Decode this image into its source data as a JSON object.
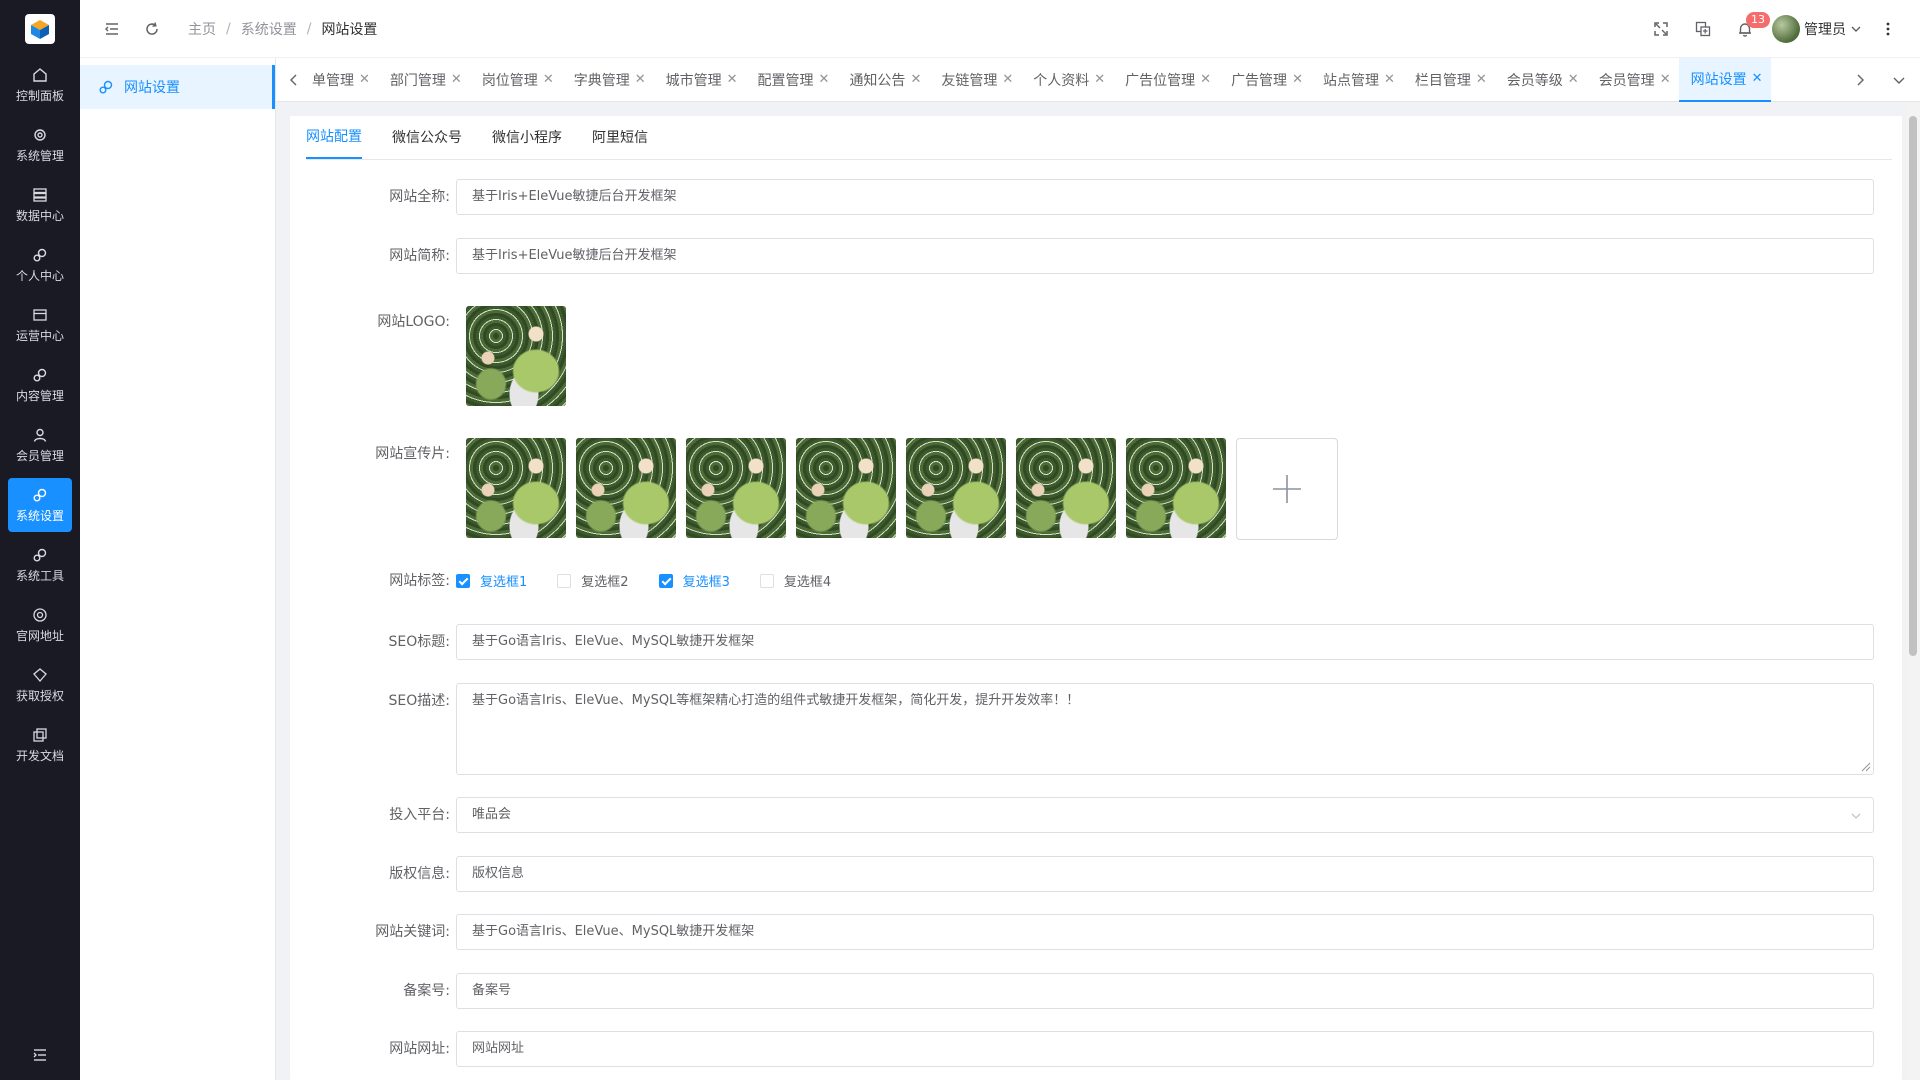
{
  "rail": {
    "items": [
      {
        "label": "控制面板",
        "icon": "home-icon"
      },
      {
        "label": "系统管理",
        "icon": "gear-icon"
      },
      {
        "label": "数据中心",
        "icon": "database-icon"
      },
      {
        "label": "个人中心",
        "icon": "gears-icon"
      },
      {
        "label": "运营中心",
        "icon": "card-icon"
      },
      {
        "label": "内容管理",
        "icon": "gears-icon"
      },
      {
        "label": "会员管理",
        "icon": "user-icon"
      },
      {
        "label": "系统设置",
        "icon": "gears-icon"
      },
      {
        "label": "系统工具",
        "icon": "gears-icon"
      },
      {
        "label": "官网地址",
        "icon": "target-icon"
      },
      {
        "label": "获取授权",
        "icon": "diamond-icon"
      },
      {
        "label": "开发文档",
        "icon": "copy-icon"
      }
    ],
    "active_index": 7
  },
  "subside": {
    "item_label": "网站设置"
  },
  "header": {
    "breadcrumb": [
      "主页",
      "系统设置",
      "网站设置"
    ],
    "notification_count": "13",
    "user_name": "管理员",
    "accent": "#1890ff"
  },
  "tabs": {
    "items": [
      "菜单管理",
      "部门管理",
      "岗位管理",
      "字典管理",
      "城市管理",
      "配置管理",
      "通知公告",
      "友链管理",
      "个人资料",
      "广告位管理",
      "广告管理",
      "站点管理",
      "栏目管理",
      "会员等级",
      "会员管理",
      "网站设置"
    ],
    "first_visible_text": "单管理",
    "active_index": 15
  },
  "subtabs": [
    "网站配置",
    "微信公众号",
    "微信小程序",
    "阿里短信"
  ],
  "form": {
    "site_name_label": "网站全称:",
    "site_name": "基于Iris+EleVue敏捷后台开发框架",
    "site_short_label": "网站简称:",
    "site_short": "基于Iris+EleVue敏捷后台开发框架",
    "logo_label": "网站LOGO:",
    "promo_label": "网站宣传片:",
    "tags_label": "网站标签:",
    "tags": [
      {
        "label": "复选框1",
        "checked": true
      },
      {
        "label": "复选框2",
        "checked": false
      },
      {
        "label": "复选框3",
        "checked": true
      },
      {
        "label": "复选框4",
        "checked": false
      }
    ],
    "seo_title_label": "SEO标题:",
    "seo_title": "基于Go语言Iris、EleVue、MySQL敏捷开发框架",
    "seo_desc_label": "SEO描述:",
    "seo_desc": "基于Go语言Iris、EleVue、MySQL等框架精心打造的组件式敏捷开发框架，简化开发，提升开发效率！！",
    "platform_label": "投入平台:",
    "platform": "唯品会",
    "copyright_label": "版权信息:",
    "copyright": "版权信息",
    "keywords_label": "网站关键词:",
    "keywords": "基于Go语言Iris、EleVue、MySQL敏捷开发框架",
    "icp_label": "备案号:",
    "icp": "备案号",
    "url_label": "网站网址:",
    "url": "网站网址"
  }
}
